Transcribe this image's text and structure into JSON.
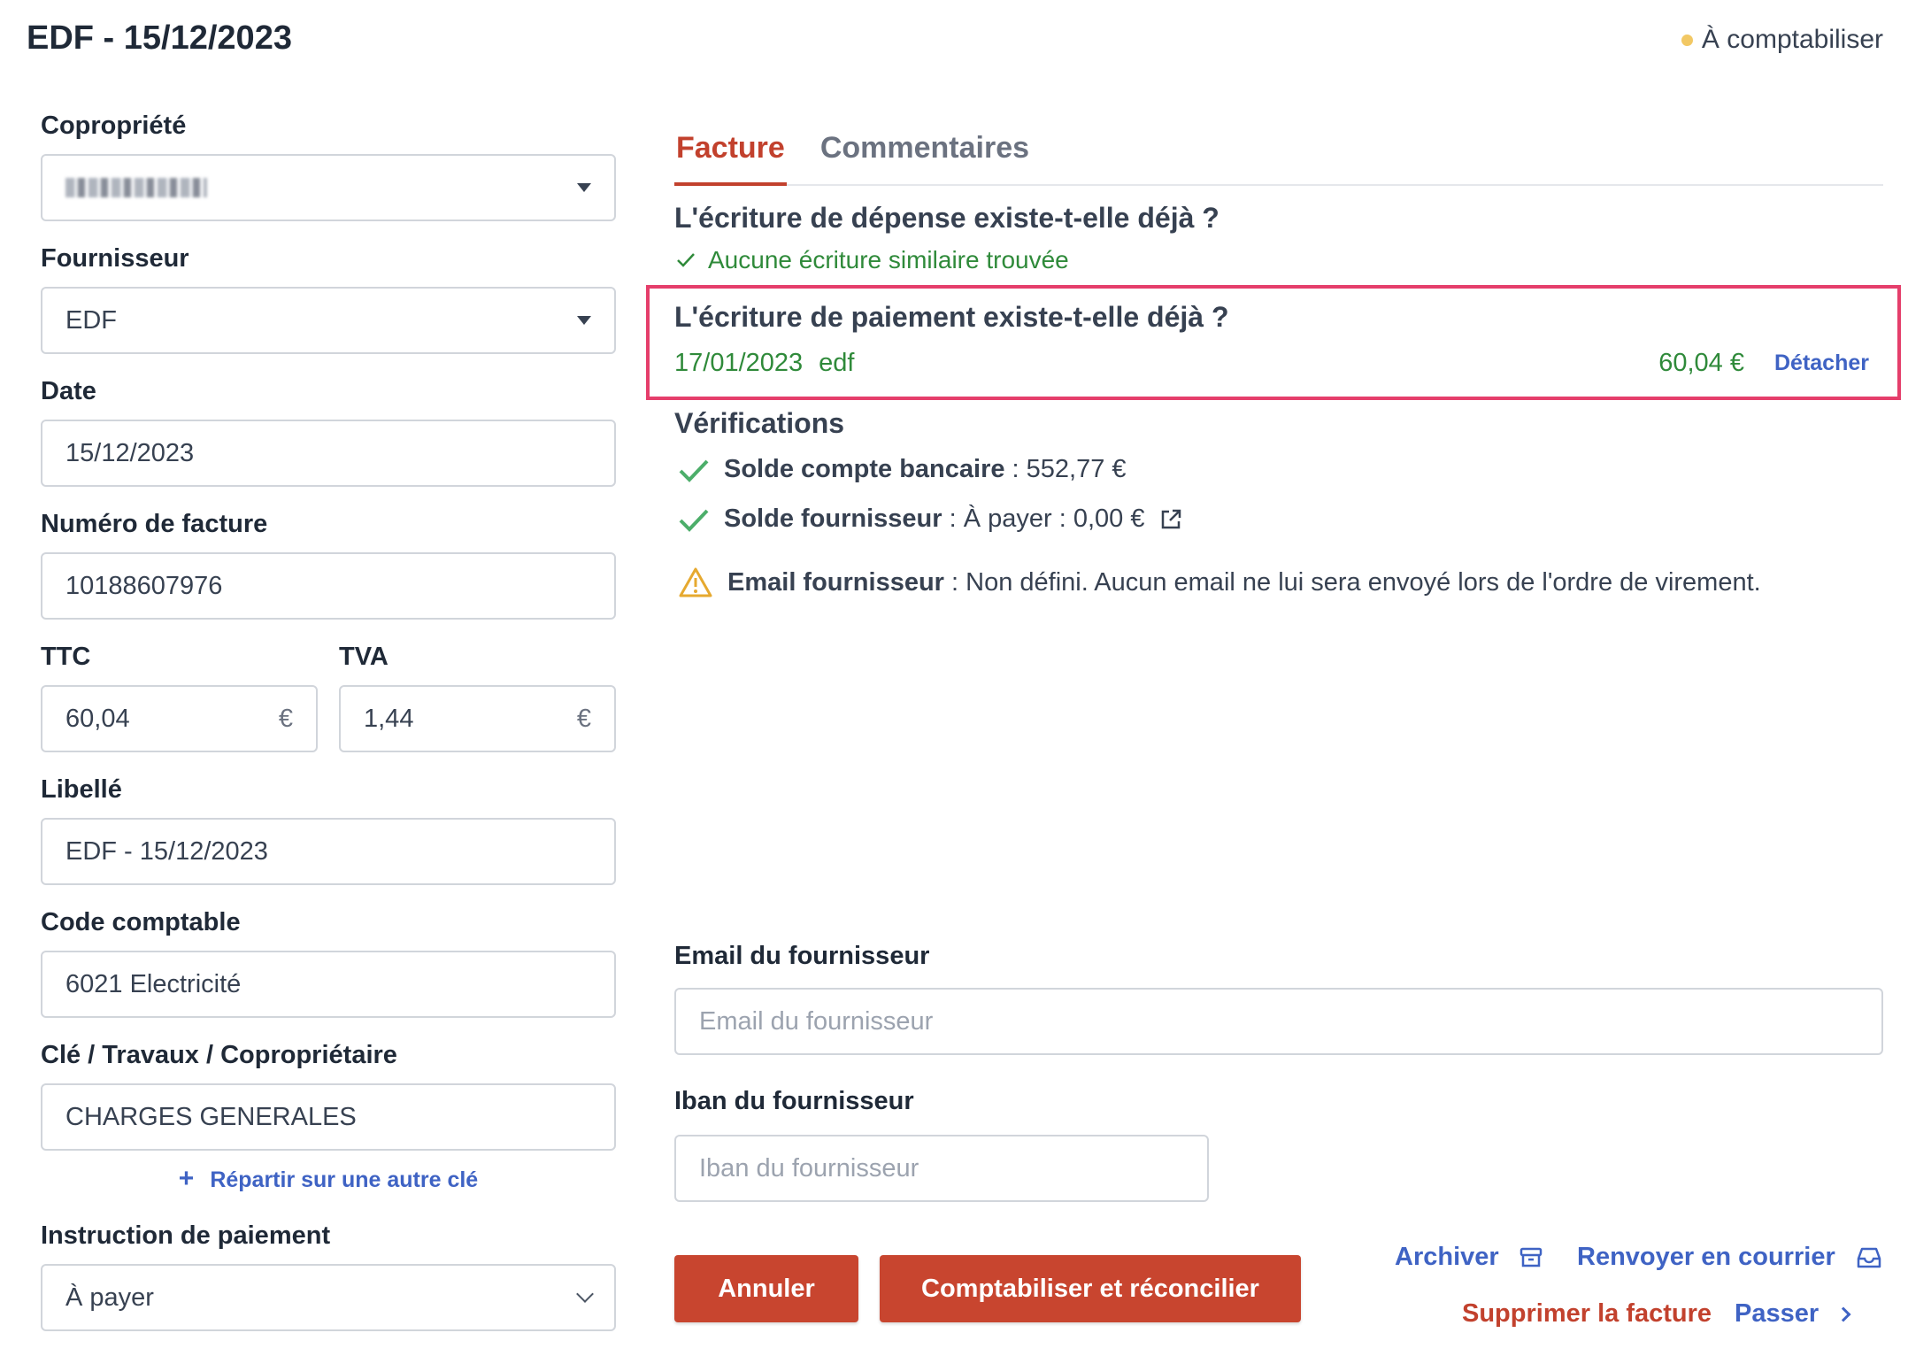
{
  "header": {
    "title": "EDF - 15/12/2023",
    "status": "À comptabiliser",
    "status_color": "#f2c864"
  },
  "form": {
    "copropriete": {
      "label": "Copropriété"
    },
    "fournisseur": {
      "label": "Fournisseur",
      "value": "EDF"
    },
    "date": {
      "label": "Date",
      "value": "15/12/2023"
    },
    "invoice_number": {
      "label": "Numéro de facture",
      "value": "10188607976"
    },
    "ttc": {
      "label": "TTC",
      "value": "60,04",
      "unit": "€"
    },
    "tva": {
      "label": "TVA",
      "value": "1,44",
      "unit": "€"
    },
    "libelle": {
      "label": "Libellé",
      "value": "EDF - 15/12/2023"
    },
    "code_comptable": {
      "label": "Code comptable",
      "value": "6021 Electricité"
    },
    "cle": {
      "label": "Clé / Travaux / Copropriétaire",
      "value": "CHARGES GENERALES"
    },
    "split_link": "Répartir sur une autre clé",
    "payment_instruction": {
      "label": "Instruction de paiement",
      "value": "À payer"
    }
  },
  "tabs": [
    {
      "label": "Facture",
      "active": true
    },
    {
      "label": "Commentaires",
      "active": false
    }
  ],
  "expense_check": {
    "title": "L'écriture de dépense existe-t-elle déjà ?",
    "result": "Aucune écriture similaire trouvée"
  },
  "payment_check": {
    "title": "L'écriture de paiement existe-t-elle déjà ?",
    "date": "17/01/2023",
    "label": "edf",
    "amount": "60,04 €",
    "detach": "Détacher",
    "highlight_color": "#e53e6b"
  },
  "verifications": {
    "title": "Vérifications",
    "items": [
      {
        "name": "Solde compte bancaire",
        "text": " : 552,77 €",
        "status": "ok"
      },
      {
        "name": "Solde fournisseur",
        "text": " : À payer : 0,00 €",
        "status": "ok"
      },
      {
        "name": "Email fournisseur",
        "text": " : Non défini. Aucun email ne lui sera envoyé lors de l'ordre de virement.",
        "status": "warning"
      }
    ]
  },
  "supplier": {
    "email_label": "Email du fournisseur",
    "email_placeholder": "Email du fournisseur",
    "iban_label": "Iban du fournisseur",
    "iban_placeholder": "Iban du fournisseur"
  },
  "actions": {
    "cancel": "Annuler",
    "submit": "Comptabiliser et réconcilier",
    "archive": "Archiver",
    "resend": "Renvoyer en courrier",
    "delete": "Supprimer la facture",
    "skip": "Passer",
    "accent_color": "#c8452f"
  }
}
